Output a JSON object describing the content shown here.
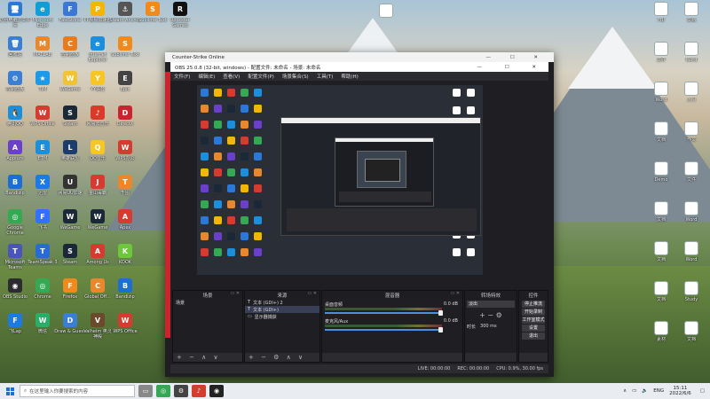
{
  "desktop_left": [
    {
      "label": "这台电脑主文件夹",
      "color": "#2a79d8",
      "glyph": "🖥"
    },
    {
      "label": "Microsoft Edge",
      "color": "#0f9ed5",
      "glyph": "e"
    },
    {
      "label": "FastStone",
      "color": "#3a78d4",
      "glyph": "F"
    },
    {
      "label": "PP视频加速器",
      "color": "#f2b705",
      "glyph": "P"
    },
    {
      "label": "Steam Anchor",
      "color": "#555",
      "glyph": "⚓"
    },
    {
      "label": "Sublime Text",
      "color": "#f08a1d",
      "glyph": "S"
    },
    {
      "label": "Rockstar Games",
      "color": "#111",
      "glyph": "R"
    },
    {
      "label": "回收站",
      "color": "#3a7fd4",
      "glyph": "🗑"
    },
    {
      "label": "MATLAB",
      "color": "#e8872b",
      "glyph": "M"
    },
    {
      "label": "控制面板",
      "color": "#e97b1c",
      "glyph": "C"
    },
    {
      "label": "Internet Explorer",
      "color": "#1b8fdc",
      "glyph": "e"
    },
    {
      "label": "Sublime Text",
      "color": "#f08a1d",
      "glyph": "S"
    },
    {
      "label": "控制面板",
      "color": "#3a7fd4",
      "glyph": "⚙"
    },
    {
      "label": "TIM",
      "color": "#1c9ae8",
      "glyph": "★"
    },
    {
      "label": "WeGame",
      "color": "#f1c232",
      "glyph": "W"
    },
    {
      "label": "YY语音",
      "color": "#f6c624",
      "glyph": "Y"
    },
    {
      "label": "Epic",
      "color": "#444",
      "glyph": "E"
    },
    {
      "label": "腾讯QQ",
      "color": "#1b8fdc",
      "glyph": "🐧"
    },
    {
      "label": "WPS Office",
      "color": "#d63b2f",
      "glyph": "W"
    },
    {
      "label": "Steam",
      "color": "#1b2838",
      "glyph": "S"
    },
    {
      "label": "网易云音乐",
      "color": "#d93a2a",
      "glyph": "♪"
    },
    {
      "label": "DirectX",
      "color": "#c9252f",
      "glyph": "D"
    },
    {
      "label": "Appium",
      "color": "#6a3fc9",
      "glyph": "A"
    },
    {
      "label": "ETM",
      "color": "#1b8fdc",
      "glyph": "E"
    },
    {
      "label": "英雄联盟",
      "color": "#1a3d6e",
      "glyph": "L"
    },
    {
      "label": "QQ音乐",
      "color": "#f6c624",
      "glyph": "Q"
    },
    {
      "label": "WPS办公",
      "color": "#d63b2f",
      "glyph": "W"
    },
    {
      "label": "Bandizip",
      "color": "#1b6fd1",
      "glyph": "B"
    },
    {
      "label": "迅雷",
      "color": "#1c7ae0",
      "glyph": "X"
    },
    {
      "label": "网易UU加速",
      "color": "#333",
      "glyph": "U"
    },
    {
      "label": "金山毒霸",
      "color": "#d63b2f",
      "glyph": "J"
    },
    {
      "label": "千图",
      "color": "#e8872b",
      "glyph": "T"
    },
    {
      "label": "Google Chrome",
      "color": "#34a853",
      "glyph": "◎"
    },
    {
      "label": "飞书",
      "color": "#3370ff",
      "glyph": "F"
    },
    {
      "label": "WeGame",
      "color": "#1b2838",
      "glyph": "W"
    },
    {
      "label": "WeGame",
      "color": "#1b2838",
      "glyph": "W"
    },
    {
      "label": "Apex",
      "color": "#d63b2f",
      "glyph": "A"
    },
    {
      "label": "Microsoft Teams",
      "color": "#4b53bc",
      "glyph": "T"
    },
    {
      "label": "TeamSpeak 3",
      "color": "#2a6ad8",
      "glyph": "T"
    },
    {
      "label": "Steam",
      "color": "#1b2838",
      "glyph": "S"
    },
    {
      "label": "Among Us",
      "color": "#d63b2f",
      "glyph": "A"
    },
    {
      "label": "KOOK",
      "color": "#6cc83a",
      "glyph": "K"
    },
    {
      "label": "OBS Studio",
      "color": "#2b2b30",
      "glyph": "◉"
    },
    {
      "label": "Chrome",
      "color": "#34a853",
      "glyph": "◎"
    },
    {
      "label": "Firefox",
      "color": "#f08a1d",
      "glyph": "F"
    },
    {
      "label": "Global Off...",
      "color": "#e8872b",
      "glyph": "C"
    },
    {
      "label": "Bandizip",
      "color": "#1b6fd1",
      "glyph": "B"
    },
    {
      "label": "飞Lap",
      "color": "#1c7ae0",
      "glyph": "F"
    },
    {
      "label": "微信",
      "color": "#2aae67",
      "glyph": "W"
    },
    {
      "label": "Draw & Guess",
      "color": "#3a7fd4",
      "glyph": "D"
    },
    {
      "label": "Valheim 英灵神殿",
      "color": "#6a4a2a",
      "glyph": "V"
    },
    {
      "label": "WPS Office",
      "color": "#d63b2f",
      "glyph": "W"
    }
  ],
  "desktop_right": [
    {
      "label": "FBI",
      "glyph": "W"
    },
    {
      "label": "文档",
      "glyph": "W"
    },
    {
      "label": "文件",
      "glyph": "W"
    },
    {
      "label": "Word",
      "glyph": "W"
    },
    {
      "label": "Word",
      "glyph": "W"
    },
    {
      "label": "入门",
      "glyph": "W"
    },
    {
      "label": "文档",
      "glyph": "W"
    },
    {
      "label": "作文",
      "glyph": "W"
    },
    {
      "label": "Demo",
      "glyph": "W"
    },
    {
      "label": "文件",
      "glyph": "W"
    },
    {
      "label": "文档",
      "glyph": "W"
    },
    {
      "label": "Word",
      "glyph": "W"
    },
    {
      "label": "文档",
      "glyph": "W"
    },
    {
      "label": "Word",
      "glyph": "W"
    },
    {
      "label": "文档",
      "glyph": "W"
    },
    {
      "label": "Study",
      "glyph": "W"
    },
    {
      "label": "素材",
      "glyph": "W"
    },
    {
      "label": "文档",
      "glyph": "W"
    }
  ],
  "projector": {
    "title": "Counter-Strike Online"
  },
  "obs": {
    "title": "OBS 25.0.8 (32-bit, windows) - 配置文件: 未命名 - 场景: 未命名",
    "menu": [
      "文件(F)",
      "编辑(E)",
      "查看(V)",
      "配置文件(P)",
      "场景集合(S)",
      "工具(T)",
      "帮助(H)"
    ],
    "docks": {
      "scenes": {
        "title": "场景",
        "items": [
          "场景"
        ]
      },
      "sources": {
        "title": "来源",
        "items": [
          "文本 (GDI+) 2",
          "文本 (GDI+)",
          "显示器捕获"
        ]
      },
      "mixer": {
        "title": "混音器",
        "tracks": [
          {
            "name": "桌面音频",
            "db": "0.0 dB"
          },
          {
            "name": "麦克风/Aux",
            "db": "0.0 dB"
          }
        ]
      },
      "transitions": {
        "title": "转场特效",
        "type": "淡出",
        "duration_label": "时长",
        "duration": "300 ms"
      },
      "controls": {
        "title": "控件",
        "buttons": [
          "停止推流",
          "开始录制",
          "工作室模式",
          "设置",
          "退出"
        ]
      }
    },
    "status": {
      "live": "LIVE: 00:00:00",
      "rec": "REC: 00:00:00",
      "cpu": "CPU: 0.9%, 30.00 fps"
    }
  },
  "taskbar": {
    "search_placeholder": "在这里输入你要搜索的内容",
    "tray_lang": "ENG",
    "time": "15:11",
    "date": "2022/6/6"
  }
}
